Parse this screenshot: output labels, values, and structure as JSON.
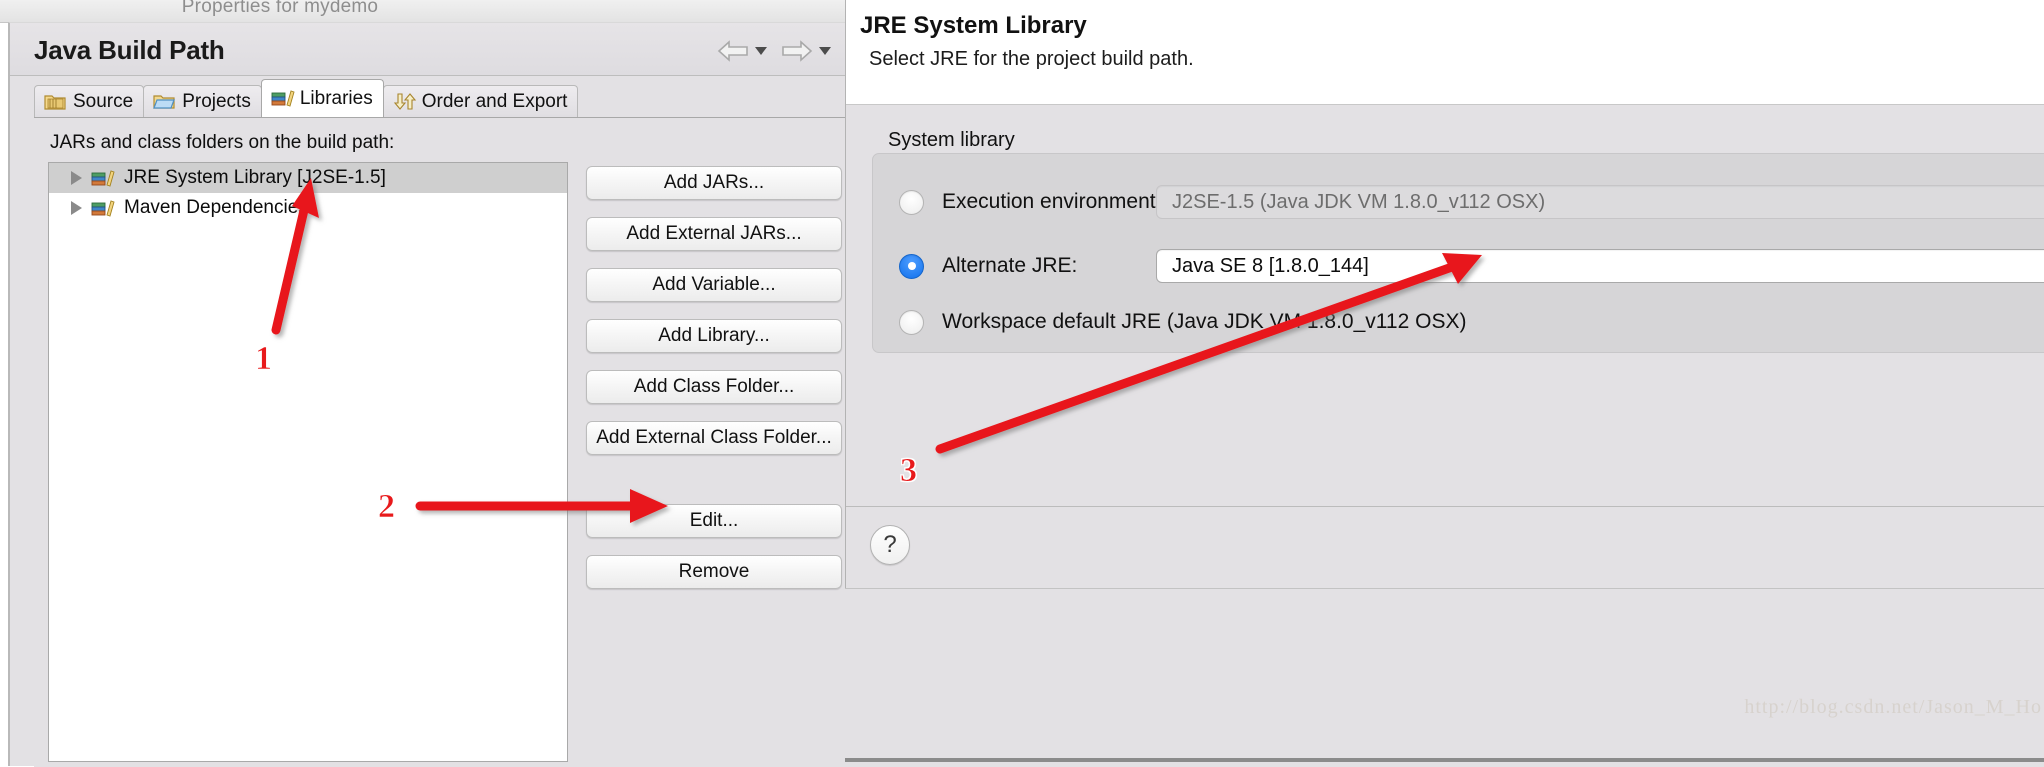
{
  "parent_window": {
    "title": "Properties for mydemo",
    "page_title": "Java Build Path",
    "nav": {
      "back_icon": "back-arrow-icon",
      "forward_icon": "forward-arrow-icon",
      "menu_icon": "chevron-down-icon"
    },
    "tabs": [
      {
        "label": "Source",
        "icon": "source-folder-icon",
        "active": false
      },
      {
        "label": "Projects",
        "icon": "projects-folder-icon",
        "active": false
      },
      {
        "label": "Libraries",
        "icon": "libraries-books-icon",
        "active": true
      },
      {
        "label": "Order and Export",
        "icon": "order-export-arrows-icon",
        "active": false
      }
    ],
    "content_label": "JARs and class folders on the build path:",
    "tree_items": [
      {
        "label": "JRE System Library [J2SE-1.5]",
        "icon": "library-books-icon",
        "selected": true,
        "expander": "collapsed-triangle-icon"
      },
      {
        "label": "Maven Dependencies",
        "icon": "library-books-icon",
        "selected": false,
        "expander": "collapsed-triangle-icon"
      }
    ],
    "buttons": [
      "Add JARs...",
      "Add External JARs...",
      "Add Variable...",
      "Add Library...",
      "Add Class Folder...",
      "Add External Class Folder...",
      "Edit...",
      "Remove"
    ]
  },
  "jre_dialog": {
    "title": "JRE System Library",
    "subtitle": "Select JRE for the project build path.",
    "group_label": "System library",
    "options": [
      {
        "label": "Execution environment:",
        "value": "J2SE-1.5 (Java JDK VM 1.8.0_v112 OSX)",
        "checked": false,
        "enabled": false,
        "has_field": true
      },
      {
        "label": "Alternate JRE:",
        "value": "Java SE 8 [1.8.0_144]",
        "checked": true,
        "enabled": true,
        "has_field": true
      },
      {
        "label": "Workspace default JRE (Java JDK VM 1.8.0_v112 OSX)",
        "value": "",
        "checked": false,
        "enabled": true,
        "has_field": false
      }
    ],
    "help_icon": "question-mark-icon",
    "help_glyph": "?"
  },
  "annotations": [
    {
      "number": "1",
      "target": "JRE System Library [J2SE-1.5] tree item"
    },
    {
      "number": "2",
      "target": "Edit... button"
    },
    {
      "number": "3",
      "target": "Alternate JRE field"
    }
  ],
  "watermark": "http://blog.csdn.net/Jason_M_Ho",
  "colors": {
    "accent_blue": "#1e7af0",
    "annotation_red": "#e8191b",
    "window_bg": "#e3e1e4",
    "selection_gray": "#cfcfcf"
  }
}
